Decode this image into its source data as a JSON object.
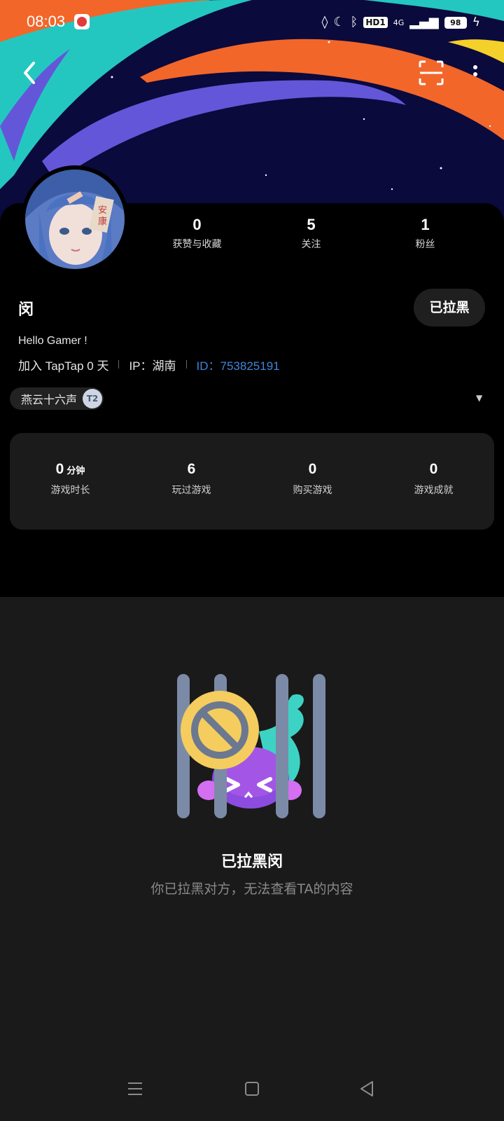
{
  "status_bar": {
    "time": "08:03",
    "hd": "HD1",
    "network": "4G",
    "battery": "98"
  },
  "icons": {
    "back": "chevron-left-icon",
    "scan": "scan-icon",
    "more": "more-vertical-icon"
  },
  "profile": {
    "stats": [
      {
        "value": "0",
        "label": "获赞与收藏"
      },
      {
        "value": "5",
        "label": "关注"
      },
      {
        "value": "1",
        "label": "粉丝"
      }
    ],
    "name": "闵",
    "blocked_button": "已拉黑",
    "bio": "Hello Gamer !",
    "joined": "加入 TapTap 0 天",
    "ip": "IP：湖南",
    "id": "ID：753825191",
    "tag": "燕云十六声",
    "tag_badge": "T2"
  },
  "game_stats": [
    {
      "value": "0",
      "unit": "分钟",
      "label": "游戏时长"
    },
    {
      "value": "6",
      "unit": "",
      "label": "玩过游戏"
    },
    {
      "value": "0",
      "unit": "",
      "label": "购买游戏"
    },
    {
      "value": "0",
      "unit": "",
      "label": "游戏成就"
    }
  ],
  "blocked_state": {
    "title": "已拉黑闵",
    "description": "你已拉黑对方，无法查看TA的内容"
  },
  "colors": {
    "accent_id": "#3f86d8",
    "panel_bg": "#000000",
    "page_bg": "#1a1a1a",
    "card_bg": "#1b1b1b"
  }
}
